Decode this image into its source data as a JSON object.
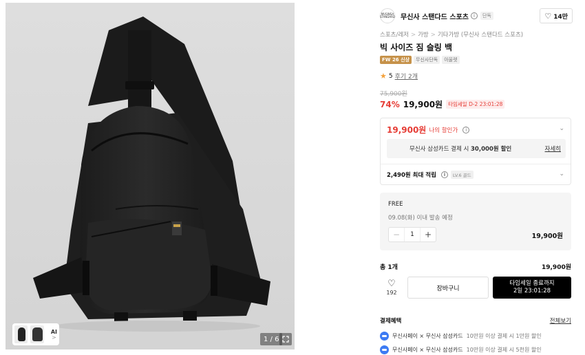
{
  "gallery": {
    "ai_label": "AI",
    "ai_arrow": ">",
    "pager": "1 / 6",
    "expand_icon": "expand-icon"
  },
  "brand": {
    "logo_text": "MUSINSA STANDARD",
    "name": "무신사 스탠다드 스포츠",
    "info_icon": "i",
    "exclusive_tag": "단독",
    "likes": "14만"
  },
  "breadcrumb": [
    "스포츠/레저",
    "가방",
    "기타가방 (무신사 스탠다드 스포츠)"
  ],
  "product": {
    "title": "빅 사이즈 짐 슬링 백",
    "tags": [
      "FW 26 신상",
      "무신사단독",
      "아울렛"
    ],
    "rating": "5",
    "review_text": "후기 2개",
    "original_price": "75,900원",
    "discount": "74%",
    "price": "19,900원",
    "timer_badge": "타임세일 D-2 23:01:28"
  },
  "my_price": {
    "price": "19,900원",
    "label": "나의 할인가",
    "info_icon": "i",
    "card_promo_prefix": "무신사 삼성카드 결제 시 ",
    "card_promo_amount": "30,000원 할인",
    "detail_link": "자세히",
    "points": "2,490원 최대 적립",
    "points_info": "i",
    "level_badge": "LV.6 골드"
  },
  "option": {
    "shipping": "FREE",
    "ship_date": "09.08(화) 이내 발송 예정",
    "minus": "−",
    "quantity": "1",
    "plus": "+",
    "price": "19,900원"
  },
  "total": {
    "label": "총 1개",
    "price": "19,900원"
  },
  "actions": {
    "wish_count": "192",
    "cart": "장바구니",
    "buy_line1": "타임세일 종료까지",
    "buy_line2": "2일 23:01:28"
  },
  "benefits": {
    "title": "결제혜택",
    "see_all": "전체보기",
    "items": [
      {
        "main": "무신사페이 × 무신사 삼성카드",
        "sub": "10만원 이상 결제 시 1만원 할인"
      },
      {
        "main": "무신사페이 × 무신사 삼성카드",
        "sub": "10만원 이상 결제 시 5천원 할인"
      }
    ]
  },
  "colors": {
    "accent_red": "#e63c35",
    "buy_button": "#000000",
    "season_tag": "#c6924a",
    "rating_star": "#f4a23c",
    "pay_icon": "#3d7bf3"
  }
}
